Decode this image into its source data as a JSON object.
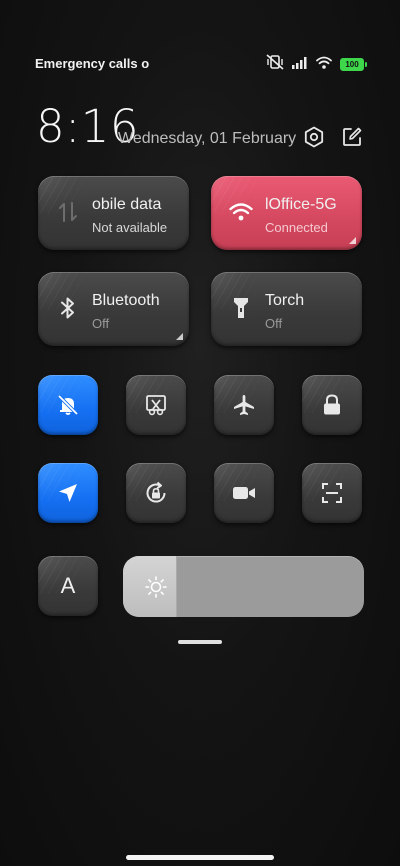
{
  "status_bar": {
    "carrier": "Emergency calls o",
    "battery": "100"
  },
  "header": {
    "time": "8:16",
    "date": "Wednesday, 01 February"
  },
  "tiles": {
    "mobile_data": {
      "title": "obile data",
      "subtitle": "Not available"
    },
    "wifi": {
      "title": "lOffice-5G",
      "subtitle": "Connected"
    },
    "bluetooth": {
      "title": "Bluetooth",
      "subtitle": "Off"
    },
    "torch": {
      "title": "Torch",
      "subtitle": "Off"
    }
  },
  "auto_brightness_label": "A",
  "brightness": {
    "level": 0.22
  },
  "colors": {
    "wifi_active": "#d4485f",
    "active_blue": "#1570f2",
    "battery_green": "#3ed64b"
  }
}
